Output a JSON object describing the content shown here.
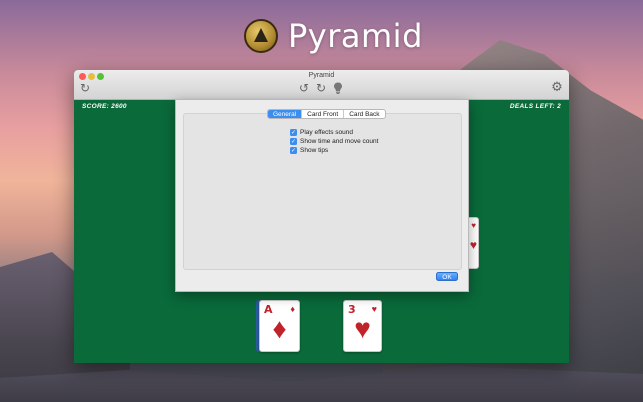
{
  "app": {
    "title": "Pyramid",
    "window_title": "Pyramid"
  },
  "game": {
    "score_label": "SCORE: 2600",
    "deals_label": "DEALS LEFT: 2",
    "cards": [
      {
        "rank": "A",
        "suit": "♦"
      },
      {
        "rank": "3",
        "suit": "♥"
      }
    ],
    "partial_card_suit": "♥"
  },
  "toolbar": {
    "refresh_icon": "↻",
    "undo_icon": "↺",
    "redo_icon": "↻",
    "hint_icon": "💡",
    "settings_icon": "⚙"
  },
  "preferences": {
    "tabs": [
      {
        "label": "General",
        "active": true
      },
      {
        "label": "Card Front",
        "active": false
      },
      {
        "label": "Card Back",
        "active": false
      }
    ],
    "options": [
      {
        "label": "Play effects sound",
        "checked": true
      },
      {
        "label": "Show time and move count",
        "checked": true
      },
      {
        "label": "Show tips",
        "checked": true
      }
    ],
    "ok_label": "OK"
  },
  "colors": {
    "felt": "#0a6a3a",
    "accent": "#3b8ef0",
    "card_red": "#c0242a"
  }
}
